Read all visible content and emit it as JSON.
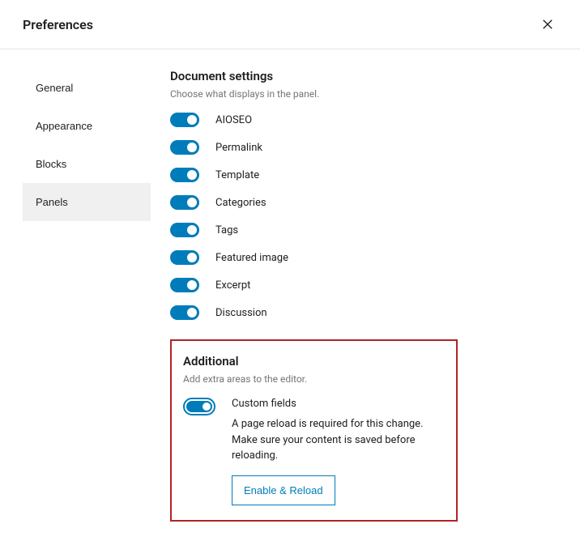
{
  "header": {
    "title": "Preferences"
  },
  "tabs": {
    "items": [
      {
        "label": "General",
        "active": false
      },
      {
        "label": "Appearance",
        "active": false
      },
      {
        "label": "Blocks",
        "active": false
      },
      {
        "label": "Panels",
        "active": true
      }
    ]
  },
  "document_settings": {
    "title": "Document settings",
    "desc": "Choose what displays in the panel.",
    "items": [
      {
        "label": "AIOSEO",
        "on": true
      },
      {
        "label": "Permalink",
        "on": true
      },
      {
        "label": "Template",
        "on": true
      },
      {
        "label": "Categories",
        "on": true
      },
      {
        "label": "Tags",
        "on": true
      },
      {
        "label": "Featured image",
        "on": true
      },
      {
        "label": "Excerpt",
        "on": true
      },
      {
        "label": "Discussion",
        "on": true
      }
    ]
  },
  "additional": {
    "title": "Additional",
    "desc": "Add extra areas to the editor.",
    "custom_fields_label": "Custom fields",
    "custom_fields_on": true,
    "note": "A page reload is required for this change. Make sure your content is saved before reloading.",
    "reload_button": "Enable & Reload"
  }
}
